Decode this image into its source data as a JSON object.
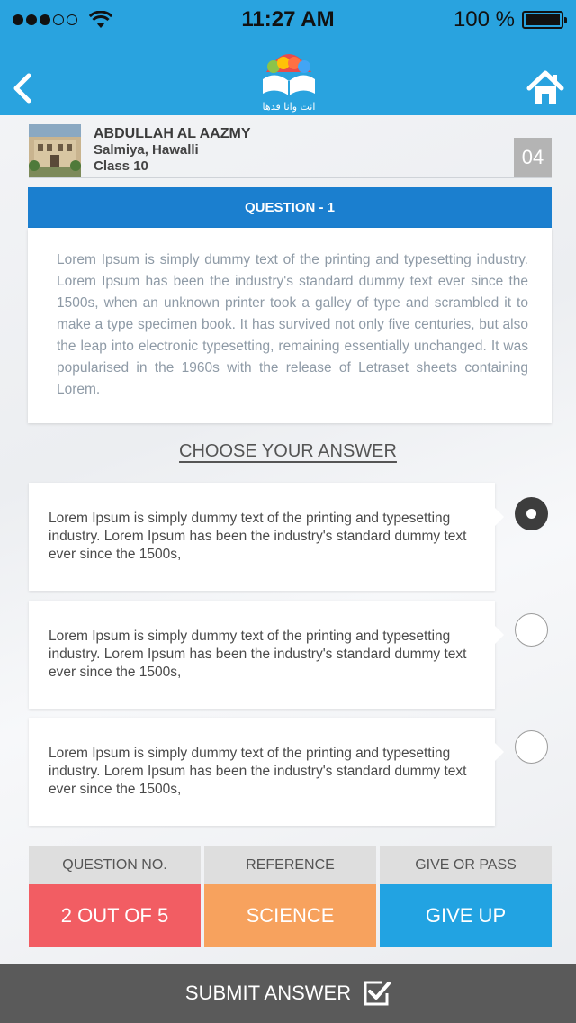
{
  "status_bar": {
    "time": "11:27 AM",
    "battery": "100 %",
    "signal_bars_filled": 3,
    "signal_bars_total": 5
  },
  "nav": {
    "back_icon": "chevron-left-icon",
    "home_icon": "home-icon",
    "logo_text": "انت وانا قدها"
  },
  "profile": {
    "name": "ABDULLAH AL AAZMY",
    "location": "Salmiya, Hawalli",
    "class": "Class 10",
    "number": "04"
  },
  "question": {
    "title": "QUESTION - 1",
    "text": "Lorem Ipsum is simply dummy text of the printing and typesetting industry. Lorem Ipsum has been the industry's standard dummy text ever since the 1500s, when an unknown printer took a galley of type and scrambled it to make a type specimen book. It has survived not only five centuries, but also the leap into electronic typesetting, remaining essentially unchanged. It was popularised in the 1960s with the release of Letraset sheets containing Lorem."
  },
  "choose_label": "CHOOSE YOUR ANSWER",
  "answers": [
    {
      "text": "Lorem Ipsum is simply dummy text of the printing and typesetting industry. Lorem Ipsum has been the industry's standard dummy text ever since the 1500s,",
      "selected": true
    },
    {
      "text": "Lorem Ipsum is simply dummy text of the printing and typesetting industry. Lorem Ipsum has been the industry's standard dummy text ever since the 1500s,",
      "selected": false
    },
    {
      "text": "Lorem Ipsum is simply dummy text of the printing and typesetting industry. Lorem Ipsum has been the industry's standard dummy text ever since the 1500s,",
      "selected": false
    }
  ],
  "stats": [
    {
      "label": "QUESTION NO.",
      "value": "2 OUT OF 5",
      "color": "#f25d63"
    },
    {
      "label": "REFERENCE",
      "value": "SCIENCE",
      "color": "#f7a25e"
    },
    {
      "label": "GIVE OR PASS",
      "value": "GIVE UP",
      "color": "#22a3e2"
    }
  ],
  "submit": {
    "label": "SUBMIT ANSWER",
    "icon": "checkbox-check-icon"
  },
  "colors": {
    "primary": "#29a3df",
    "question_header": "#1b7fcf",
    "submit_bar": "#5a5a5a"
  }
}
